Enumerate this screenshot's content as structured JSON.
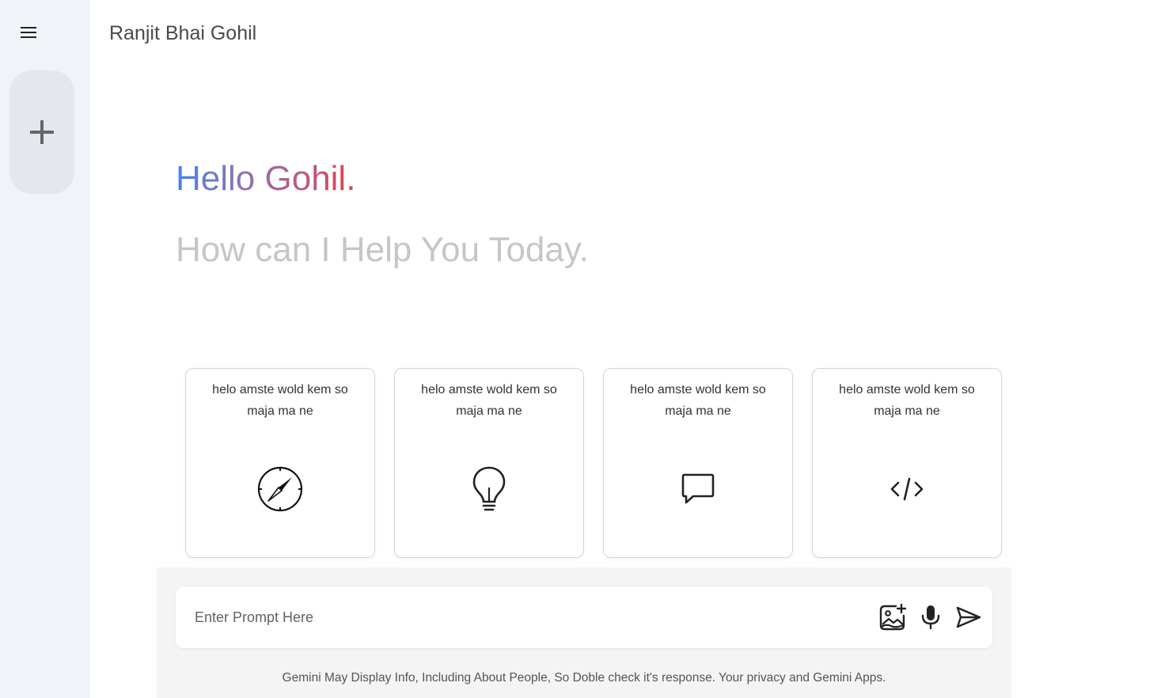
{
  "sidebar": {
    "menu_icon": "hamburger-menu-icon",
    "new_chat_icon": "plus-icon"
  },
  "header": {
    "title": "Ranjit Bhai Gohil"
  },
  "greeting": {
    "hello": "Hello Gohil.",
    "subtitle": "How can I Help You Today."
  },
  "cards": [
    {
      "text": "helo amste wold kem so maja ma ne",
      "icon": "compass-icon"
    },
    {
      "text": "helo amste wold kem so maja ma ne",
      "icon": "lightbulb-icon"
    },
    {
      "text": "helo amste wold kem so maja ma ne",
      "icon": "message-icon"
    },
    {
      "text": "helo amste wold kem so maja ma ne",
      "icon": "code-icon"
    }
  ],
  "prompt": {
    "placeholder": "Enter Prompt Here",
    "value": "",
    "actions": [
      "add-image-icon",
      "mic-icon",
      "send-icon"
    ]
  },
  "footer": {
    "note": "Gemini May Display Info, Including About People, So Doble check it's response. Your privacy and Gemini Apps."
  },
  "colors": {
    "sidebar_bg": "#f0f4f9",
    "gradient_start": "#4b82ee",
    "gradient_end": "#e0414f",
    "subtitle": "#c4c7c5"
  }
}
